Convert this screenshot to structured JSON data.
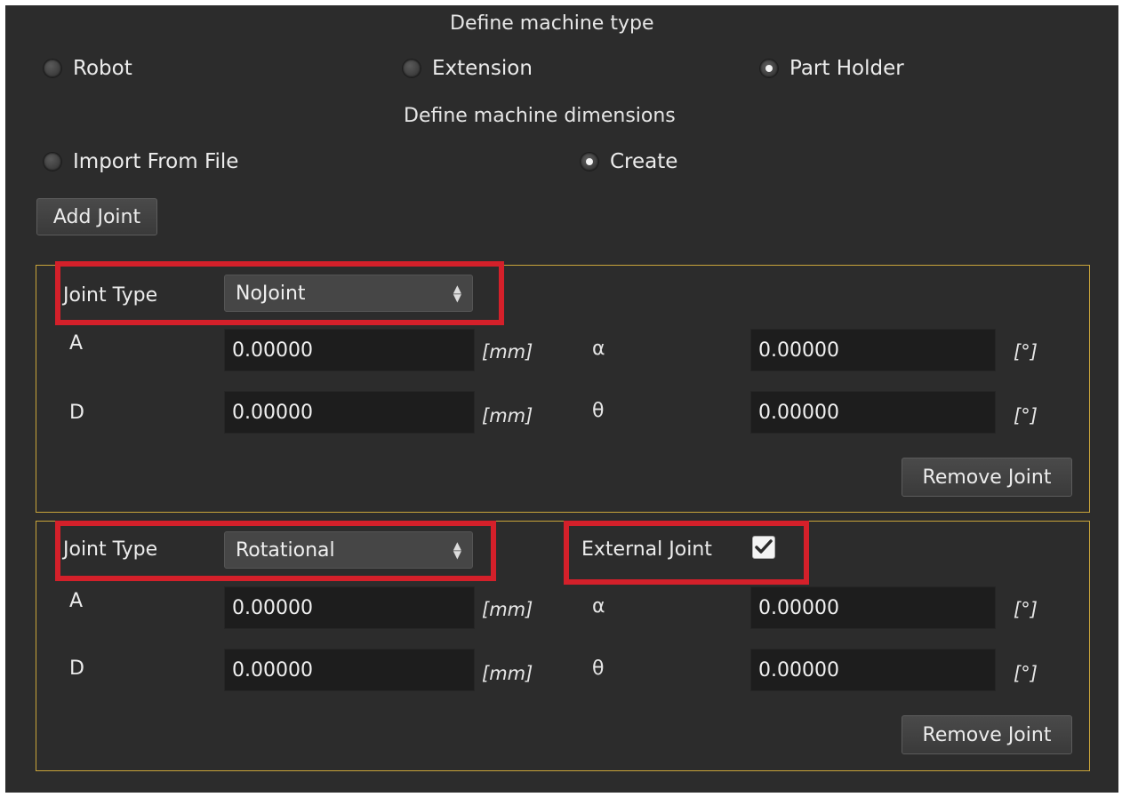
{
  "machine_type": {
    "heading": "Define machine type",
    "options": [
      {
        "label": "Robot",
        "checked": false
      },
      {
        "label": "Extension",
        "checked": false
      },
      {
        "label": "Part Holder",
        "checked": true
      }
    ]
  },
  "dimensions": {
    "heading": "Define machine dimensions",
    "options": [
      {
        "label": "Import From File",
        "checked": false
      },
      {
        "label": "Create",
        "checked": true
      }
    ]
  },
  "add_joint_label": "Add Joint",
  "joints": [
    {
      "joint_type_label": "Joint Type",
      "joint_type_value": "NoJoint",
      "a_label": "A",
      "a_value": "0.00000",
      "a_unit": "[mm]",
      "alpha_label": "α",
      "alpha_value": "0.00000",
      "alpha_unit": "[°]",
      "d_label": "D",
      "d_value": "0.00000",
      "d_unit": "[mm]",
      "theta_label": "θ",
      "theta_value": "0.00000",
      "theta_unit": "[°]",
      "remove_label": "Remove Joint"
    },
    {
      "joint_type_label": "Joint Type",
      "joint_type_value": "Rotational",
      "external_label": "External Joint",
      "external_checked": true,
      "a_label": "A",
      "a_value": "0.00000",
      "a_unit": "[mm]",
      "alpha_label": "α",
      "alpha_value": "0.00000",
      "alpha_unit": "[°]",
      "d_label": "D",
      "d_value": "0.00000",
      "d_unit": "[mm]",
      "theta_label": "θ",
      "theta_value": "0.00000",
      "theta_unit": "[°]",
      "remove_label": "Remove Joint"
    }
  ],
  "colors": {
    "background": "#2c2c2c",
    "group_border": "#c9a43a",
    "highlight": "#d4202a",
    "field_bg": "#1d1d1d"
  }
}
